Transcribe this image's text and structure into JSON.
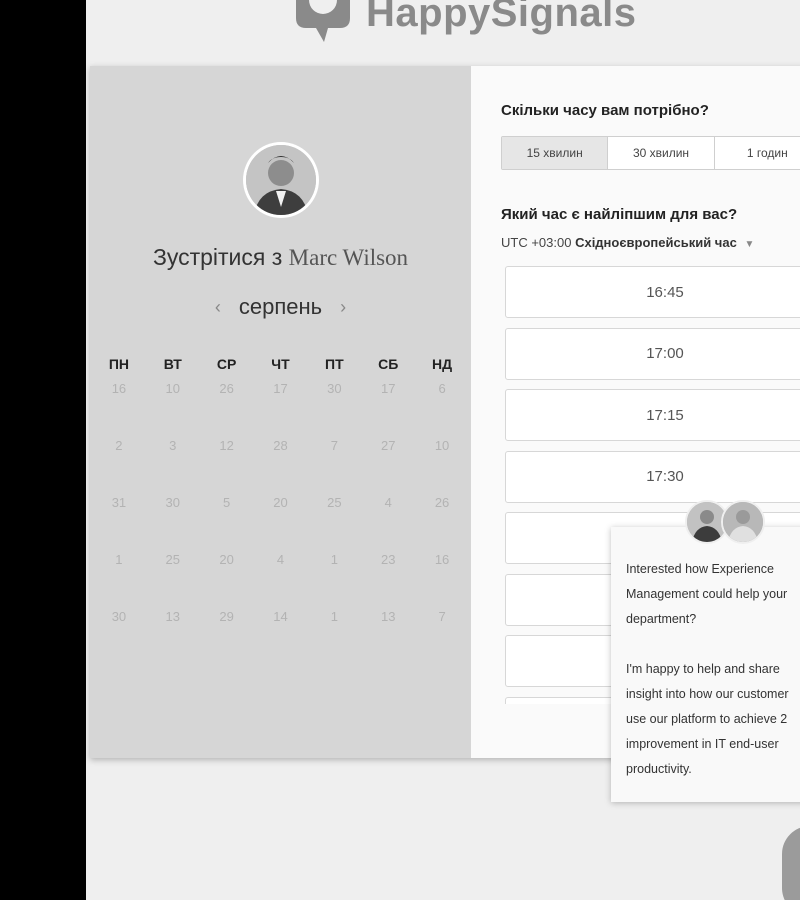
{
  "brand": {
    "name": "HappySignals"
  },
  "host": {
    "title_prefix": "Зустрітися з",
    "name": "Marc Wilson"
  },
  "calendar": {
    "month": "серпень",
    "prev_icon": "chevron-left-icon",
    "next_icon": "chevron-right-icon",
    "weekdays": [
      "ПН",
      "ВТ",
      "СР",
      "ЧТ",
      "ПТ",
      "СБ",
      "НД"
    ],
    "weeks": [
      [
        "16",
        "10",
        "26",
        "17",
        "30",
        "17",
        "6"
      ],
      [
        "2",
        "3",
        "12",
        "28",
        "7",
        "27",
        "10"
      ],
      [
        "31",
        "30",
        "5",
        "20",
        "25",
        "4",
        "26"
      ],
      [
        "1",
        "25",
        "20",
        "4",
        "1",
        "23",
        "16"
      ],
      [
        "30",
        "13",
        "29",
        "14",
        "1",
        "13",
        "7"
      ]
    ]
  },
  "duration": {
    "question": "Скільки часу вам потрібно?",
    "options": [
      "15 хвилин",
      "30 хвилин",
      "1 годин"
    ],
    "selected": "15 хвилин"
  },
  "time": {
    "question": "Який час є найліпшим для вас?",
    "tz_offset": "UTC +03:00",
    "tz_name": "Східноєвропейський час",
    "slots": [
      "16:45",
      "17:00",
      "17:15",
      "17:30",
      "",
      "",
      "",
      ""
    ]
  },
  "chat": {
    "line1": "Interested how Experience",
    "line2": "Management could help your",
    "line3": "department?",
    "line4": "I'm happy to help and share",
    "line5": "insight into how our customer",
    "line6": "use our platform to achieve 2",
    "line7": "improvement in IT end-user",
    "line8": "productivity."
  },
  "colors": {
    "left_panel": "#d6d6d6",
    "page_bg": "#efefef"
  }
}
